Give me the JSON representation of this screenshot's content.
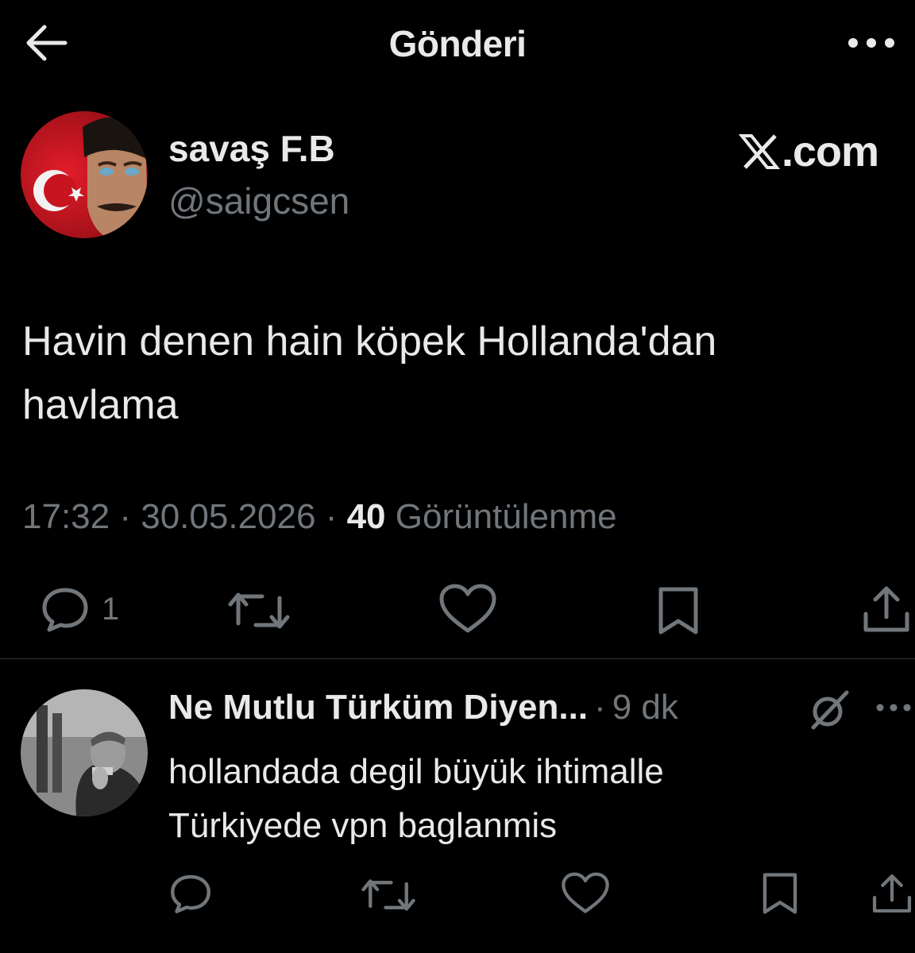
{
  "header": {
    "title": "Gönderi",
    "back_icon": "arrow-left-icon",
    "more_icon": "more-horizontal-icon"
  },
  "tweet": {
    "author_name": "savaş F.B",
    "author_handle": "@saigcsen",
    "watermark": ".com",
    "text_line1": "Havin denen hain köpek Hollanda'dan",
    "text_line2": "havlama",
    "time": "17:32",
    "date": "30.05.2026",
    "separator": "·",
    "views_count": "40",
    "views_label": "Görüntülenme",
    "actions": {
      "reply_count": "1",
      "icons": [
        "reply-icon",
        "retweet-icon",
        "like-icon",
        "bookmark-icon",
        "share-icon"
      ]
    }
  },
  "reply": {
    "author_name": "Ne Mutlu Türküm Diyen...",
    "separator": "·",
    "time": "9 dk",
    "text_line1": "hollandada degil büyük ihtimalle",
    "text_line2": "Türkiyede vpn baglanmis",
    "icons": [
      "grok-icon",
      "more-horizontal-icon",
      "reply-icon",
      "retweet-icon",
      "like-icon",
      "bookmark-icon",
      "share-icon"
    ]
  },
  "colors": {
    "background": "#000000",
    "text": "#e7e9ea",
    "muted": "#71767b",
    "divider": "#2f3336"
  }
}
